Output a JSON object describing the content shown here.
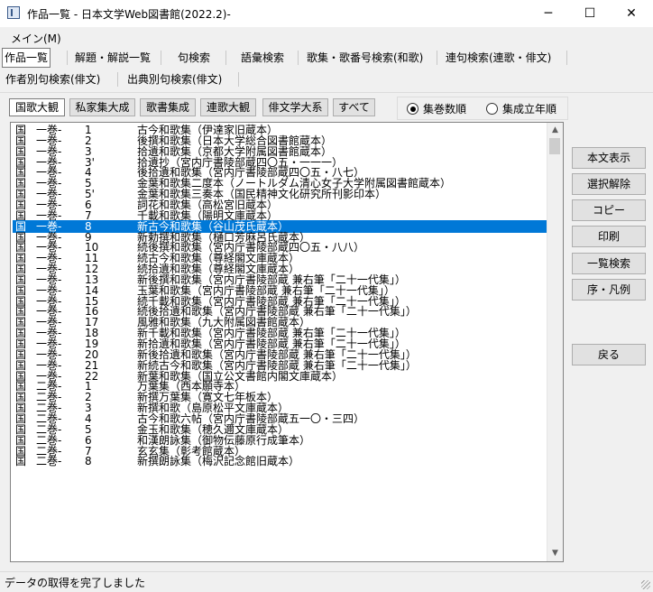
{
  "window": {
    "title": "作品一覧 - 日本文学Web図書館(2022.2)-",
    "minimize": "─",
    "maximize": "☐",
    "close": "✕"
  },
  "menu": {
    "main": "メイン(M)"
  },
  "tabs_row1": [
    "作品一覧",
    "解題・解説一覧",
    "句検索",
    "語彙検索",
    "歌集・歌番号検索(和歌)",
    "連句検索(連歌・俳文)"
  ],
  "tabs_row2": [
    "作者別句検索(俳文)",
    "出典別句検索(俳文)"
  ],
  "filters": [
    "国歌大観",
    "私家集大成",
    "歌書集成",
    "連歌大観",
    "俳文学大系",
    "すべて"
  ],
  "sort_options": [
    "集巻数順",
    "集成立年順"
  ],
  "selected_sort": "集巻数順",
  "list": [
    [
      "国",
      "一巻-",
      "1",
      "古今和歌集（伊達家旧蔵本）"
    ],
    [
      "国",
      "一巻-",
      "2",
      "後撰和歌集（日本大学総合図書館蔵本）"
    ],
    [
      "国",
      "一巻-",
      "3",
      "拾遺和歌集（京都大学附属図書館蔵本）"
    ],
    [
      "国",
      "一巻-",
      "3'",
      "拾遺抄（宮内庁書陵部蔵四〇五・一一一）"
    ],
    [
      "国",
      "一巻-",
      "4",
      "後拾遺和歌集（宮内庁書陵部蔵四〇五・八七）"
    ],
    [
      "国",
      "一巻-",
      "5",
      "金葉和歌集二度本（ノートルダム清心女子大学附属図書館蔵本）"
    ],
    [
      "国",
      "一巻-",
      "5'",
      "金葉和歌集三奏本（国民精神文化研究所刊影印本）"
    ],
    [
      "国",
      "一巻-",
      "6",
      "詞花和歌集（高松宮旧蔵本）"
    ],
    [
      "国",
      "一巻-",
      "7",
      "千載和歌集（陽明文庫蔵本）"
    ],
    [
      "国",
      "一巻-",
      "8",
      "新古今和歌集（谷山茂氏蔵本）"
    ],
    [
      "国",
      "一巻-",
      "9",
      "新勅撰和歌集（樋口芳麻呂氏蔵本）"
    ],
    [
      "国",
      "一巻-",
      "10",
      "続後撰和歌集（宮内庁書陵部蔵四〇五・八八）"
    ],
    [
      "国",
      "一巻-",
      "11",
      "続古今和歌集（尊経閣文庫蔵本）"
    ],
    [
      "国",
      "一巻-",
      "12",
      "続拾遺和歌集（尊経閣文庫蔵本）"
    ],
    [
      "国",
      "一巻-",
      "13",
      "新後撰和歌集（宮内庁書陵部蔵 兼右筆「二十一代集」）"
    ],
    [
      "国",
      "一巻-",
      "14",
      "玉葉和歌集（宮内庁書陵部蔵 兼右筆「二十一代集」）"
    ],
    [
      "国",
      "一巻-",
      "15",
      "続千載和歌集（宮内庁書陵部蔵 兼右筆「二十一代集」）"
    ],
    [
      "国",
      "一巻-",
      "16",
      "続後拾遺和歌集（宮内庁書陵部蔵 兼右筆「二十一代集」）"
    ],
    [
      "国",
      "一巻-",
      "17",
      "風雅和歌集（九大附属図書館蔵本）"
    ],
    [
      "国",
      "一巻-",
      "18",
      "新千載和歌集（宮内庁書陵部蔵 兼右筆「二十一代集」）"
    ],
    [
      "国",
      "一巻-",
      "19",
      "新拾遺和歌集（宮内庁書陵部蔵 兼右筆「二十一代集」）"
    ],
    [
      "国",
      "一巻-",
      "20",
      "新後拾遺和歌集（宮内庁書陵部蔵 兼右筆「二十一代集」）"
    ],
    [
      "国",
      "一巻-",
      "21",
      "新続古今和歌集（宮内庁書陵部蔵 兼右筆「二十一代集」）"
    ],
    [
      "国",
      "一巻-",
      "22",
      "新葉和歌集（国立公文書館内閣文庫蔵本）"
    ],
    [
      "国",
      "二巻-",
      "1",
      "万葉集（西本願寺本）"
    ],
    [
      "国",
      "二巻-",
      "2",
      "新撰万葉集（寛文七年板本）"
    ],
    [
      "国",
      "二巻-",
      "3",
      "新撰和歌（島原松平文庫蔵本）"
    ],
    [
      "国",
      "二巻-",
      "4",
      "古今和歌六帖（宮内庁書陵部蔵五一〇・三四）"
    ],
    [
      "国",
      "二巻-",
      "5",
      "金玉和歌集（穂久邇文庫蔵本）"
    ],
    [
      "国",
      "二巻-",
      "6",
      "和漢朗詠集（御物伝藤原行成筆本）"
    ],
    [
      "国",
      "二巻-",
      "7",
      "玄玄集（彰考館蔵本）"
    ],
    [
      "国",
      "二巻-",
      "8",
      "新撰朗詠集（梅沢記念館旧蔵本）"
    ]
  ],
  "selected_index": 9,
  "side_buttons": [
    "本文表示",
    "選択解除",
    "コピー",
    "印刷",
    "一覧検索",
    "序・凡例",
    "戻る"
  ],
  "status": "データの取得を完了しました",
  "colors": {
    "selection": "#0078d7"
  }
}
